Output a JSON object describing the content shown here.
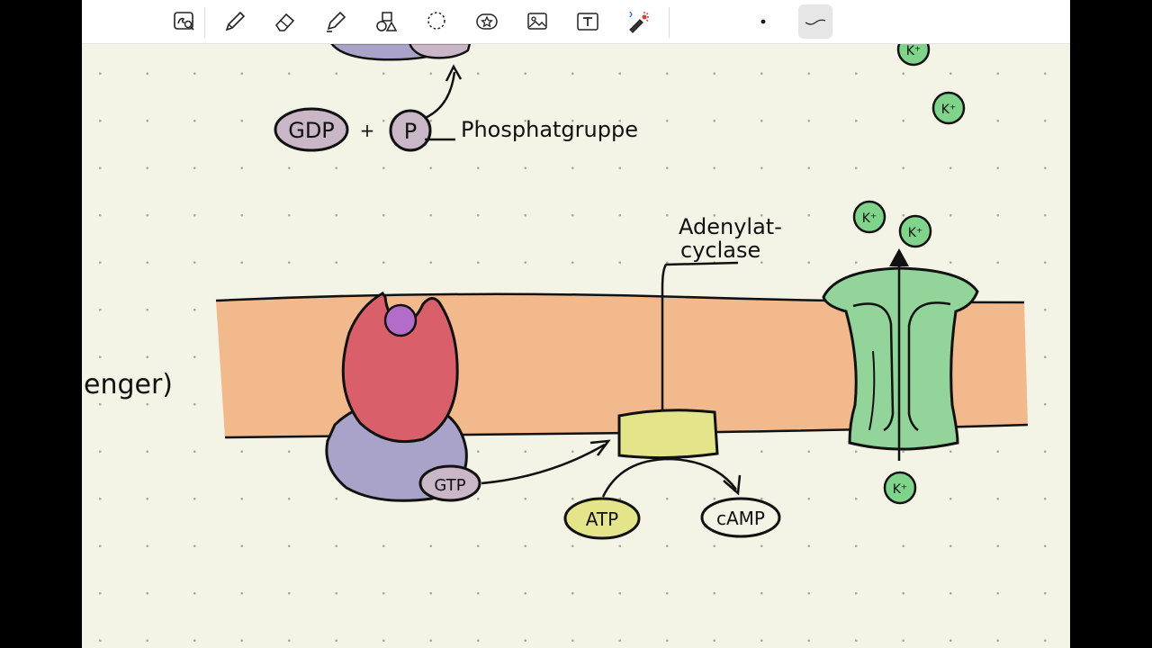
{
  "toolbar": {
    "tools": [
      {
        "id": "lasso-search",
        "icon": "lasso-search-icon"
      },
      {
        "id": "pen",
        "icon": "pen-icon"
      },
      {
        "id": "eraser",
        "icon": "eraser-icon"
      },
      {
        "id": "highlighter",
        "icon": "highlighter-icon"
      },
      {
        "id": "shapes",
        "icon": "shapes-icon"
      },
      {
        "id": "lasso",
        "icon": "lasso-icon"
      },
      {
        "id": "sticker",
        "icon": "sticker-icon"
      },
      {
        "id": "image",
        "icon": "image-icon"
      },
      {
        "id": "text",
        "icon": "text-icon"
      },
      {
        "id": "laser-pointer",
        "icon": "laser-pointer-icon"
      }
    ],
    "pen_sizes": [
      {
        "id": "dot",
        "icon": "dot-size-icon"
      },
      {
        "id": "stroke",
        "icon": "stroke-size-icon",
        "selected": true
      }
    ]
  },
  "notes": {
    "gdp_label": "GDP",
    "plus": "+",
    "p_label": "P",
    "phosphat_label": "Phosphatgruppe",
    "adenylat_line1": "Adenylat-",
    "adenylat_line2": "cyclase",
    "gtp_label": "GTP",
    "atp_label": "ATP",
    "camp_label": "cAMP",
    "k_ion": "K⁺",
    "partial_left_text": "enger)"
  },
  "colors": {
    "membrane": "#f2b98c",
    "receptor": "#d9606a",
    "ligand": "#b46cc9",
    "g_protein": "#a9a3c9",
    "gtp_gdp": "#c9b6c6",
    "adenylate_cyclase": "#e4e58b",
    "channel": "#93d49b",
    "k_ion": "#7fd38a",
    "ink": "#111111"
  }
}
